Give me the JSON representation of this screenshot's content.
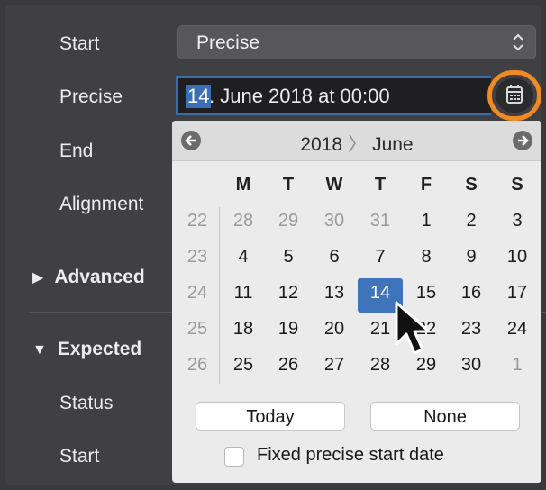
{
  "sidebar": {
    "start_label": "Start",
    "precise_label": "Precise",
    "end_label": "End",
    "alignment_label": "Alignment",
    "advanced_label": "Advanced",
    "expected_label": "Expected",
    "status_label": "Status",
    "start2_label": "Start",
    "collapsed_icon": "triangle-right-icon",
    "expanded_icon": "triangle-down-icon"
  },
  "start_select": {
    "value": "Precise",
    "icon": "up-down-chevron-icon"
  },
  "date_field": {
    "day_segment": "14",
    "rest": ". June 2018 at 00:00"
  },
  "calendar_button": {
    "icon": "calendar-icon",
    "highlight_color": "#f08a24"
  },
  "calendar": {
    "year": "2018",
    "month": "June",
    "prev_icon": "arrow-left-circle-icon",
    "next_icon": "arrow-right-circle-icon",
    "weekdays": [
      "M",
      "T",
      "W",
      "T",
      "F",
      "S",
      "S"
    ],
    "weeks": [
      {
        "week": "22",
        "days": [
          "28",
          "29",
          "30",
          "31",
          "1",
          "2",
          "3"
        ]
      },
      {
        "week": "23",
        "days": [
          "4",
          "5",
          "6",
          "7",
          "8",
          "9",
          "10"
        ]
      },
      {
        "week": "24",
        "days": [
          "11",
          "12",
          "13",
          "14",
          "15",
          "16",
          "17"
        ]
      },
      {
        "week": "25",
        "days": [
          "18",
          "19",
          "20",
          "21",
          "22",
          "23",
          "24"
        ]
      },
      {
        "week": "26",
        "days": [
          "25",
          "26",
          "27",
          "28",
          "29",
          "30",
          "1"
        ]
      }
    ],
    "selected_day": "14",
    "selected_color": "#3f73ba",
    "today_button": "Today",
    "none_button": "None",
    "checkbox_label": "Fixed precise start date",
    "checkbox_checked": false
  },
  "cursor_icon": "mouse-pointer-icon"
}
